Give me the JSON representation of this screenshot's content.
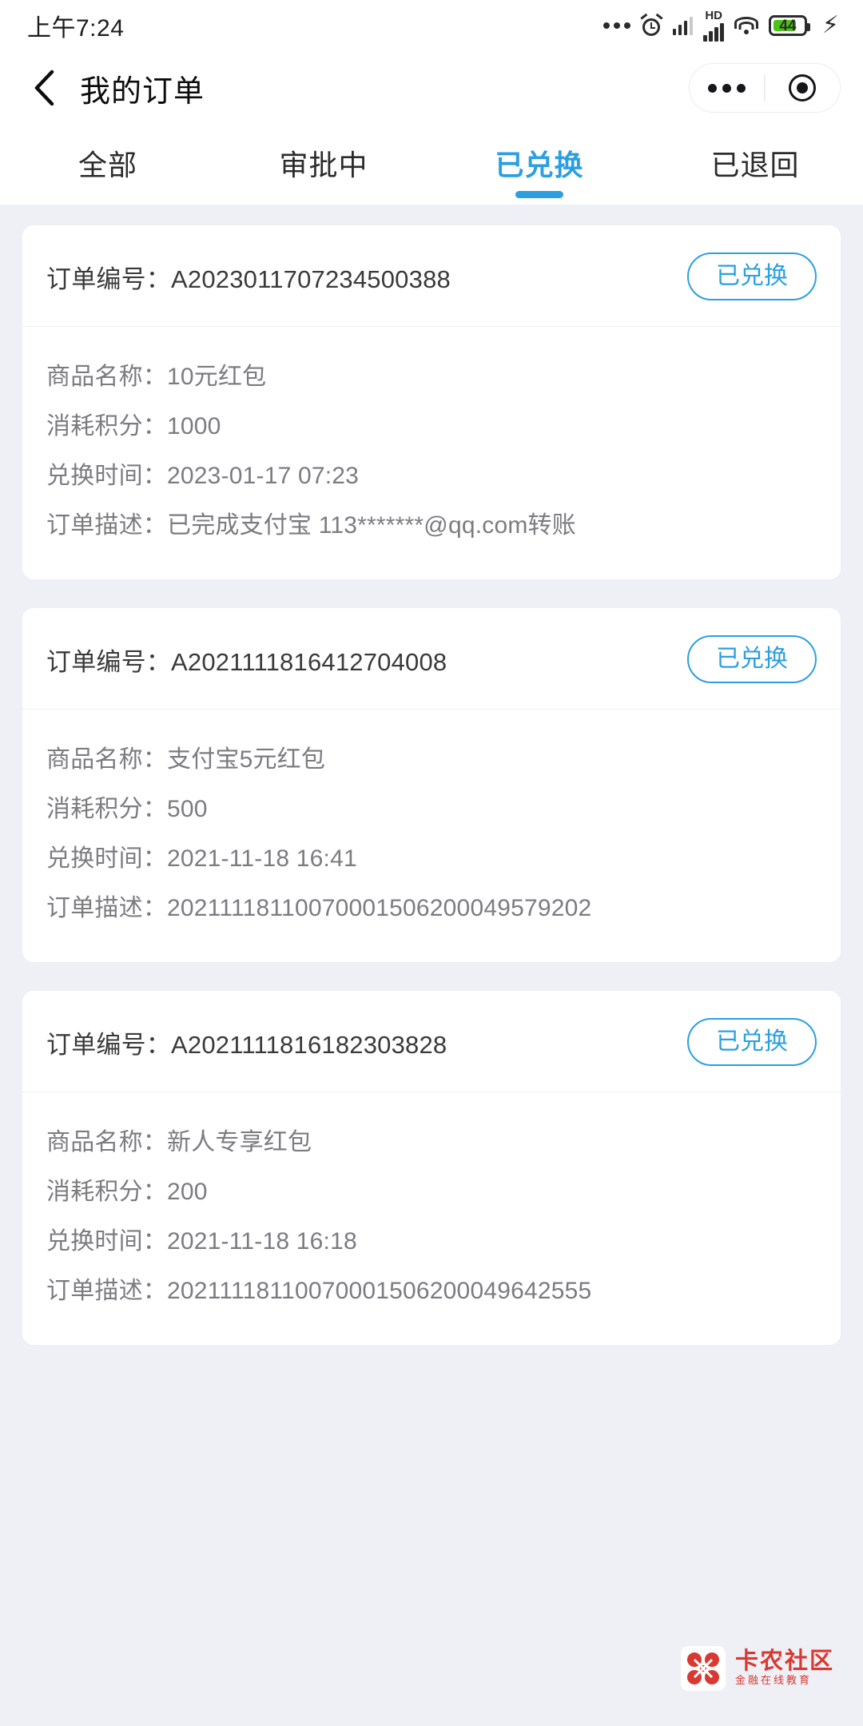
{
  "statusbar": {
    "time": "上午7:24",
    "hd_label": "HD",
    "battery_level": "44",
    "icons": [
      "more-dots-icon",
      "alarm-clock-icon",
      "signal-bars-icon",
      "hd-signal-icon",
      "wifi-icon",
      "battery-icon",
      "charging-bolt-icon"
    ]
  },
  "navbar": {
    "back_icon": "chevron-left-icon",
    "title": "我的订单",
    "capsule": {
      "more_icon": "more-dots-icon",
      "target_icon": "target-circle-icon"
    }
  },
  "tabs": [
    {
      "label": "全部",
      "active": false
    },
    {
      "label": "审批中",
      "active": false
    },
    {
      "label": "已兑换",
      "active": true
    },
    {
      "label": "已退回",
      "active": false
    }
  ],
  "labels": {
    "order_no": "订单编号：",
    "goods_name": "商品名称：",
    "points": "消耗积分：",
    "exchange_time": "兑换时间：",
    "description": "订单描述："
  },
  "orders": [
    {
      "order_no": "A2023011707234500388",
      "status": "已兑换",
      "goods_name": "10元红包",
      "points": "1000",
      "exchange_time": "2023-01-17 07:23",
      "description": "已完成支付宝 113*******@qq.com转账"
    },
    {
      "order_no": "A2021111816412704008",
      "status": "已兑换",
      "goods_name": "支付宝5元红包",
      "points": "500",
      "exchange_time": "2021-11-18 16:41",
      "description": "20211118110070001506200049579202"
    },
    {
      "order_no": "A2021111816182303828",
      "status": "已兑换",
      "goods_name": "新人专享红包",
      "points": "200",
      "exchange_time": "2021-11-18 16:18",
      "description": "20211118110070001506200049642555"
    }
  ],
  "watermark": {
    "title": "卡农社区",
    "subtitle": "金融在线教育",
    "logo_icon": "kanong-flower-logo-icon"
  },
  "colors": {
    "accent": "#2b9fe0",
    "page_bg": "#eef0f5",
    "card_bg": "#ffffff",
    "text_primary": "#3a3a3a",
    "text_secondary": "#7c7c80",
    "battery_green": "#4cc417",
    "watermark_red": "#d8342c"
  }
}
